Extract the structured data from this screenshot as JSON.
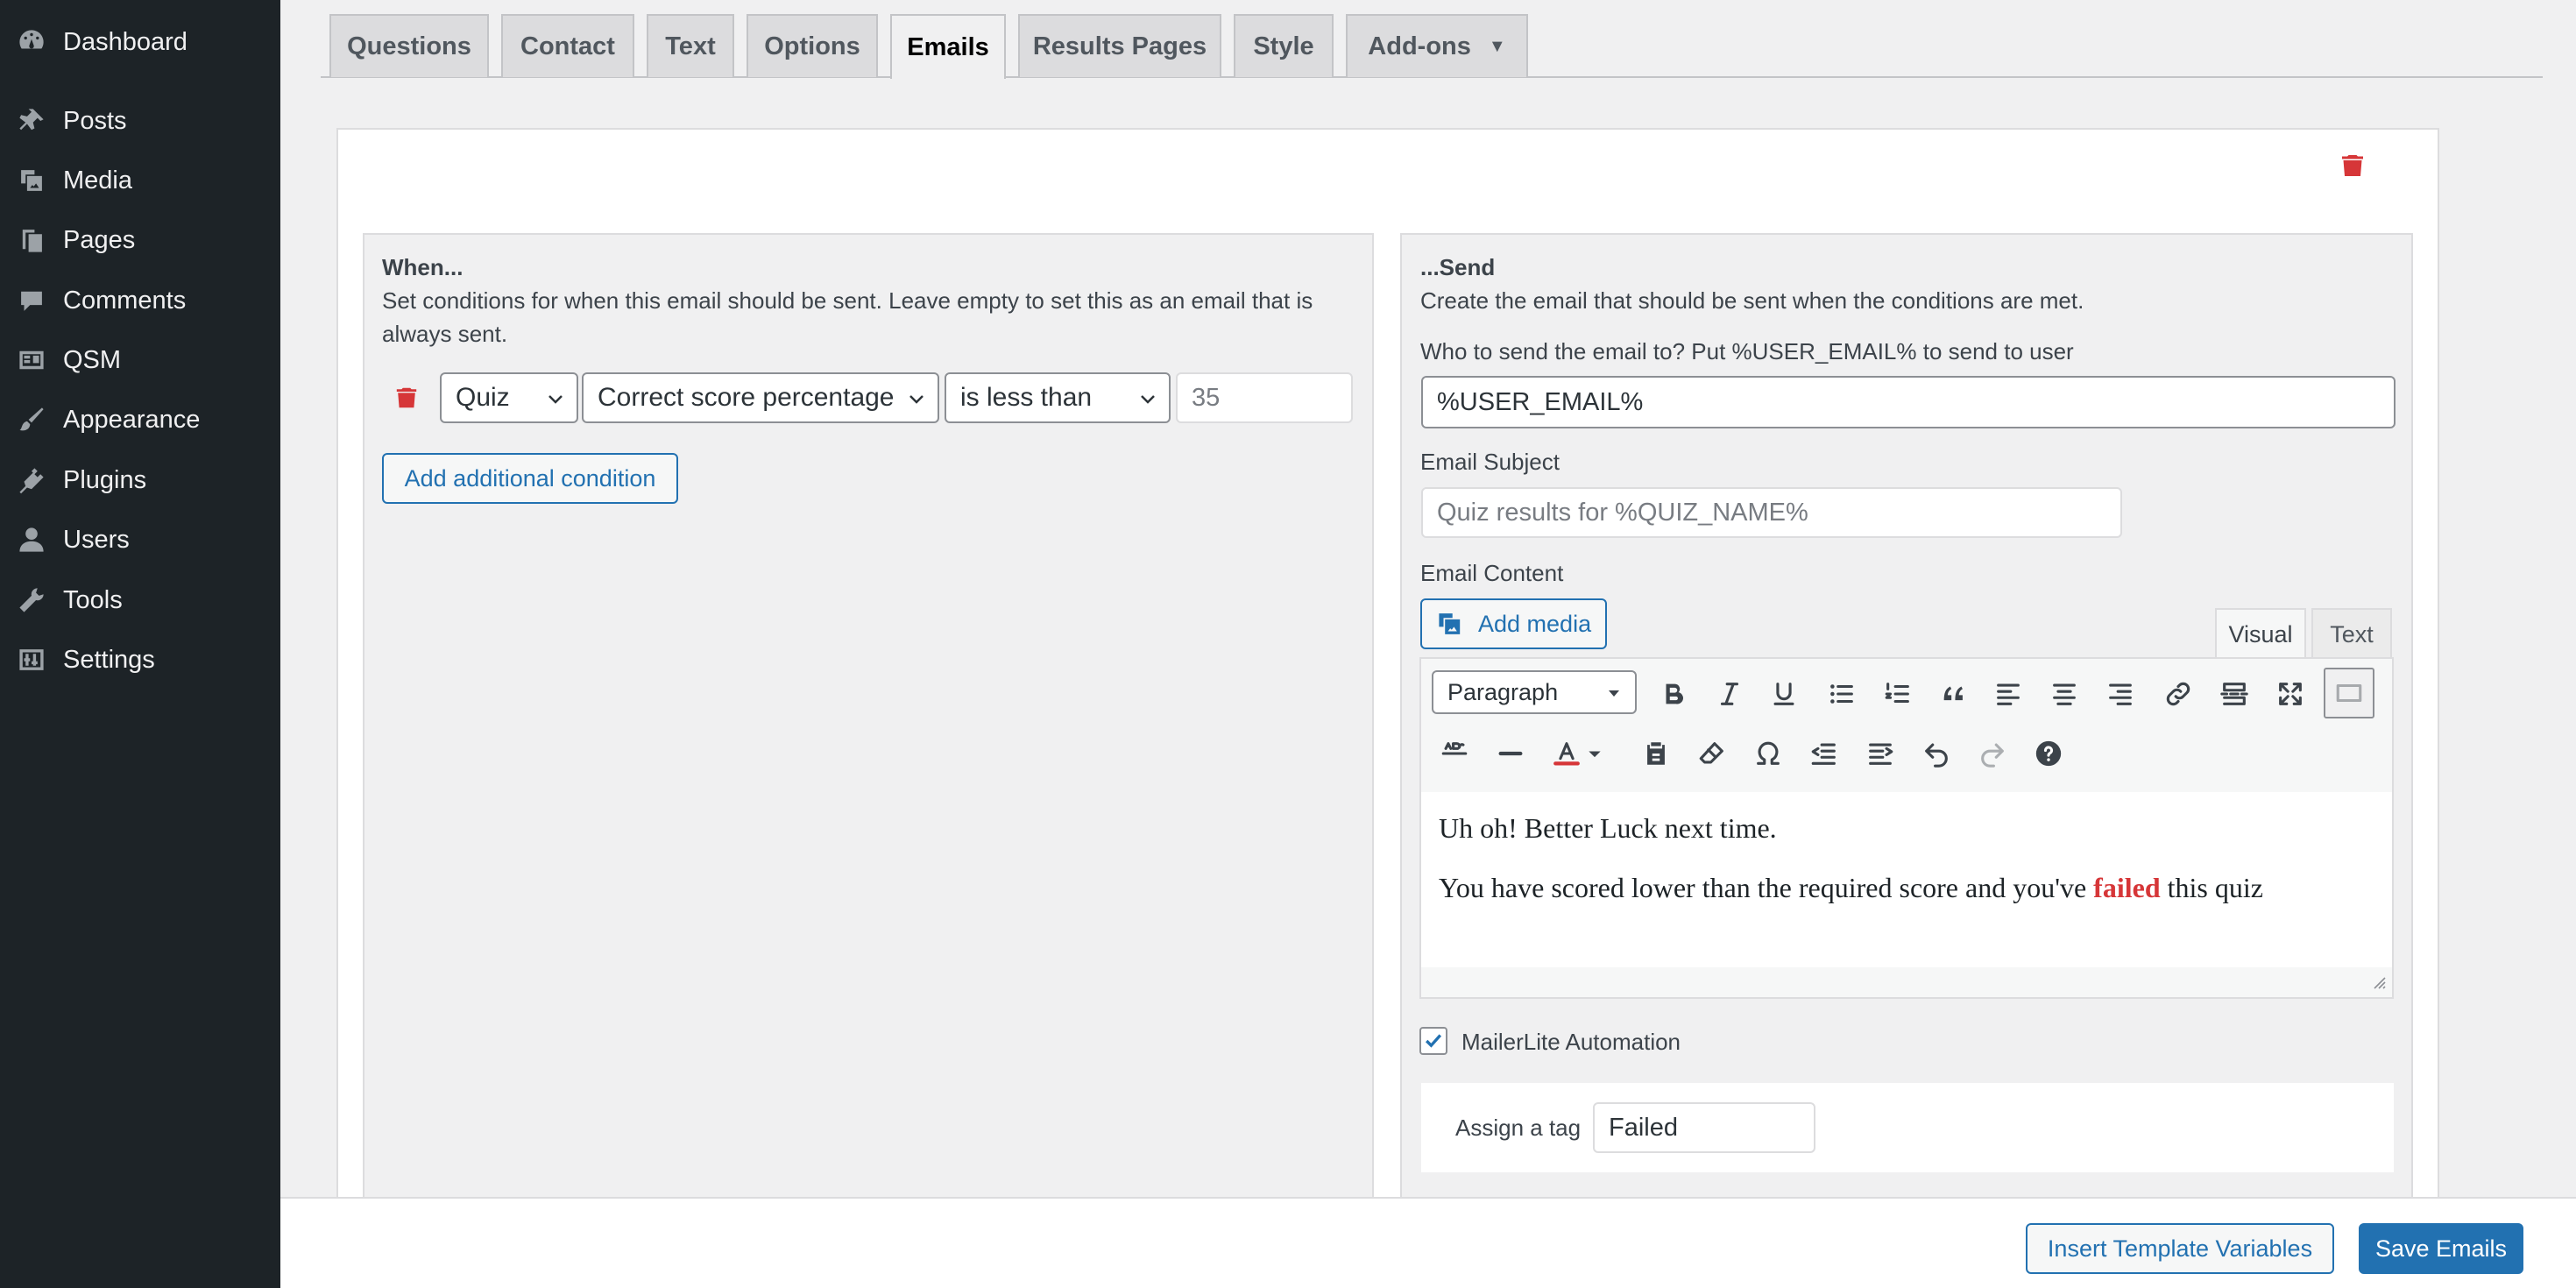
{
  "sidebar": {
    "items": [
      {
        "label": "Dashboard",
        "icon": "dashboard-icon"
      },
      {
        "label": "Posts",
        "icon": "pin-icon"
      },
      {
        "label": "Media",
        "icon": "media-icon"
      },
      {
        "label": "Pages",
        "icon": "pages-icon"
      },
      {
        "label": "Comments",
        "icon": "comment-icon"
      },
      {
        "label": "QSM",
        "icon": "qsm-icon"
      },
      {
        "label": "Appearance",
        "icon": "brush-icon"
      },
      {
        "label": "Plugins",
        "icon": "plug-icon"
      },
      {
        "label": "Users",
        "icon": "user-icon"
      },
      {
        "label": "Tools",
        "icon": "wrench-icon"
      },
      {
        "label": "Settings",
        "icon": "settings-icon"
      }
    ]
  },
  "tabs": [
    {
      "label": "Questions"
    },
    {
      "label": "Contact"
    },
    {
      "label": "Text"
    },
    {
      "label": "Options"
    },
    {
      "label": "Emails",
      "active": true
    },
    {
      "label": "Results Pages"
    },
    {
      "label": "Style"
    },
    {
      "label": "Add-ons",
      "dropdown_glyph": "▼"
    }
  ],
  "when": {
    "heading": "When...",
    "description": "Set conditions for when this email should be sent. Leave empty to set this as an email that is always sent.",
    "condition": {
      "category": "Quiz",
      "criteria": "Correct score percentage",
      "operator": "is less than",
      "value": "35"
    },
    "add_condition_label": "Add additional condition"
  },
  "send": {
    "heading": "...Send",
    "description": "Create the email that should be sent when the conditions are met.",
    "to_label": "Who to send the email to? Put %USER_EMAIL% to send to user",
    "to_value": "%USER_EMAIL%",
    "subject_label": "Email Subject",
    "subject_placeholder": "Quiz results for %QUIZ_NAME%",
    "content_label": "Email Content",
    "add_media_label": "Add media",
    "editor_tabs": {
      "visual": "Visual",
      "text": "Text"
    },
    "format_select": "Paragraph",
    "content_line1": "Uh oh! Better Luck next time.",
    "content_line2_before": "You have scored lower than the required score and you've ",
    "content_line2_bold": "failed",
    "content_line2_after": " this quiz",
    "mailerlite_label": "MailerLite Automation",
    "mailerlite_checked": true,
    "assign_tag_label": "Assign a tag",
    "assign_tag_value": "Failed"
  },
  "footer": {
    "insert_label": "Insert Template Variables",
    "save_label": "Save Emails"
  },
  "colors": {
    "sidebar_bg": "#1d2327",
    "accent": "#2271b1",
    "danger": "#d63638"
  }
}
